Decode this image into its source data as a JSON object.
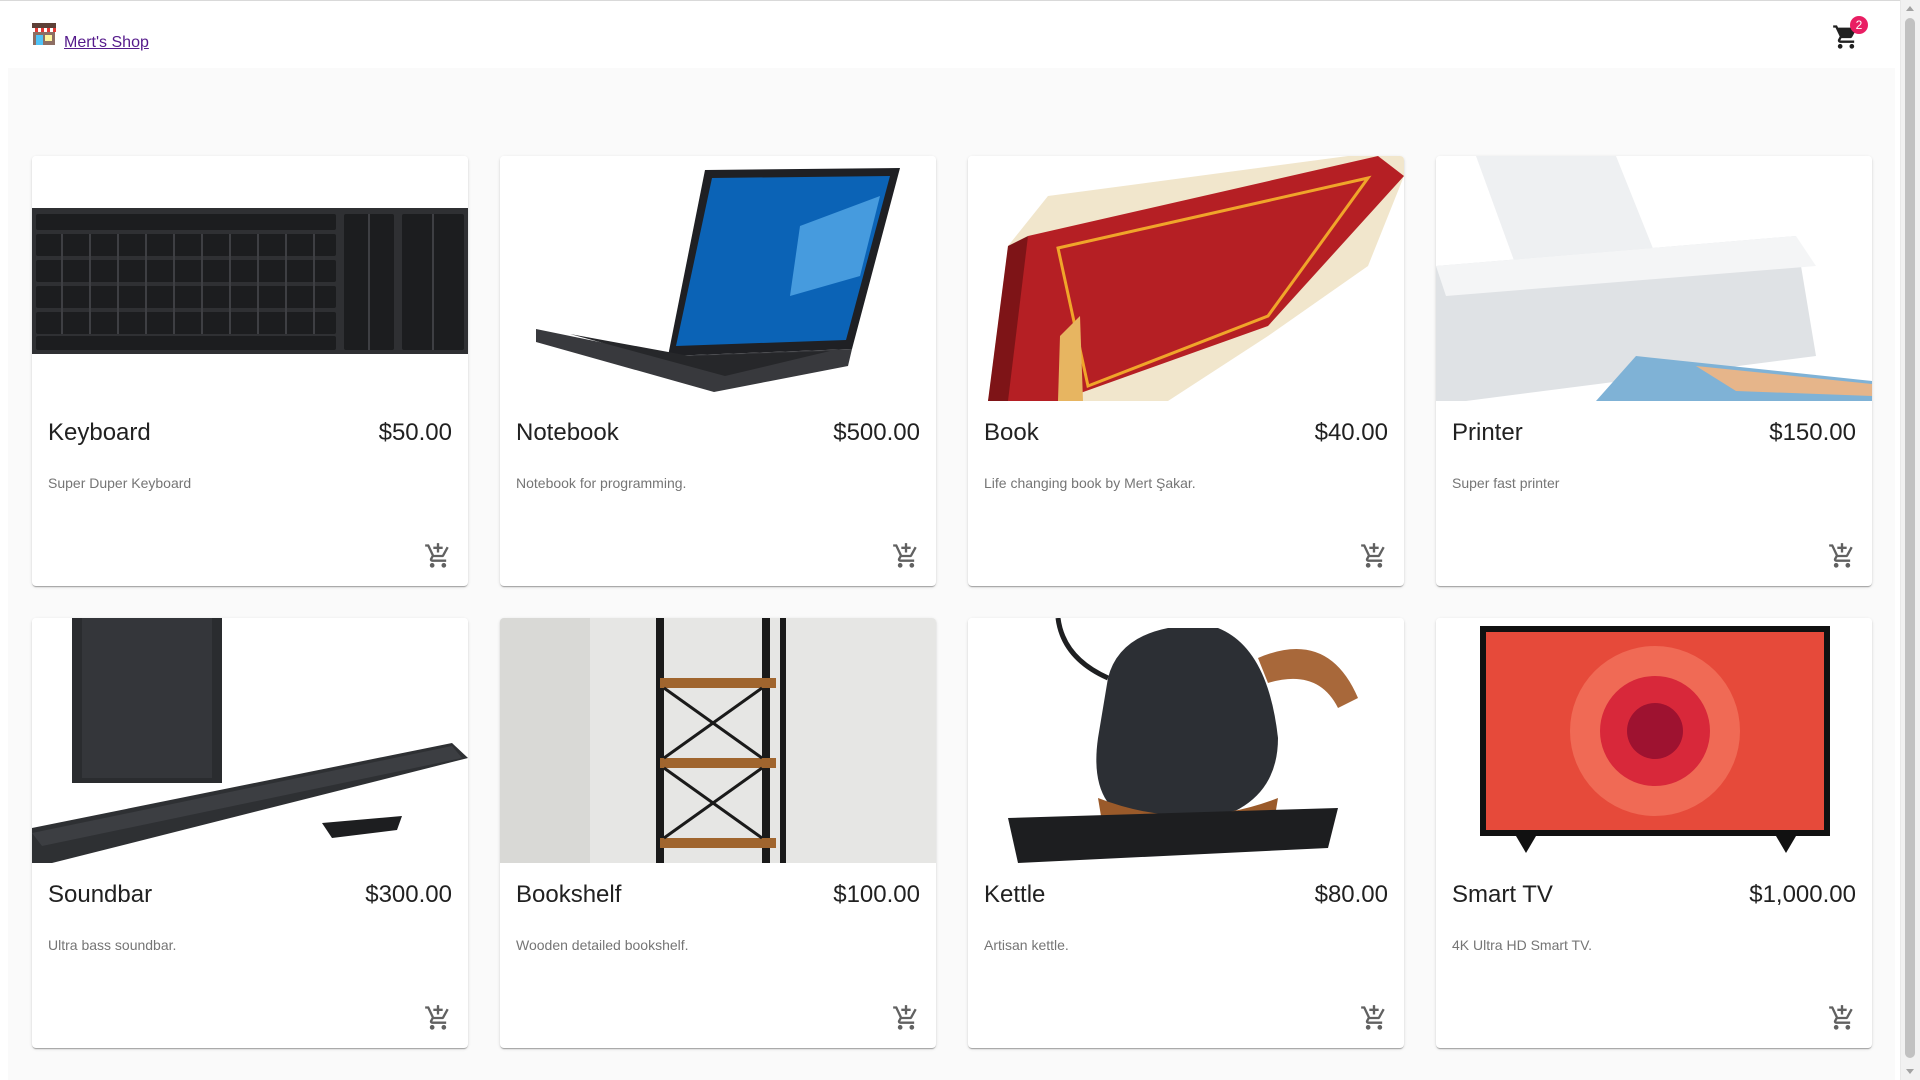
{
  "header": {
    "brand_label": "Mert's Shop",
    "cart_count": "2",
    "badge_color": "#e91e63"
  },
  "products": [
    {
      "name": "Keyboard",
      "price": "$50.00",
      "description": "Super Duper Keyboard"
    },
    {
      "name": "Notebook",
      "price": "$500.00",
      "description": "Notebook for programming."
    },
    {
      "name": "Book",
      "price": "$40.00",
      "description": "Life changing book by Mert Şakar."
    },
    {
      "name": "Printer",
      "price": "$150.00",
      "description": "Super fast printer"
    },
    {
      "name": "Soundbar",
      "price": "$300.00",
      "description": "Ultra bass soundbar."
    },
    {
      "name": "Bookshelf",
      "price": "$100.00",
      "description": "Wooden detailed bookshelf."
    },
    {
      "name": "Kettle",
      "price": "$80.00",
      "description": "Artisan kettle."
    },
    {
      "name": "Smart TV",
      "price": "$1,000.00",
      "description": "4K Ultra HD Smart TV."
    }
  ],
  "icons": {
    "brand": "shop-icon",
    "cart": "shopping-cart-icon",
    "add": "add-shopping-cart-icon"
  }
}
